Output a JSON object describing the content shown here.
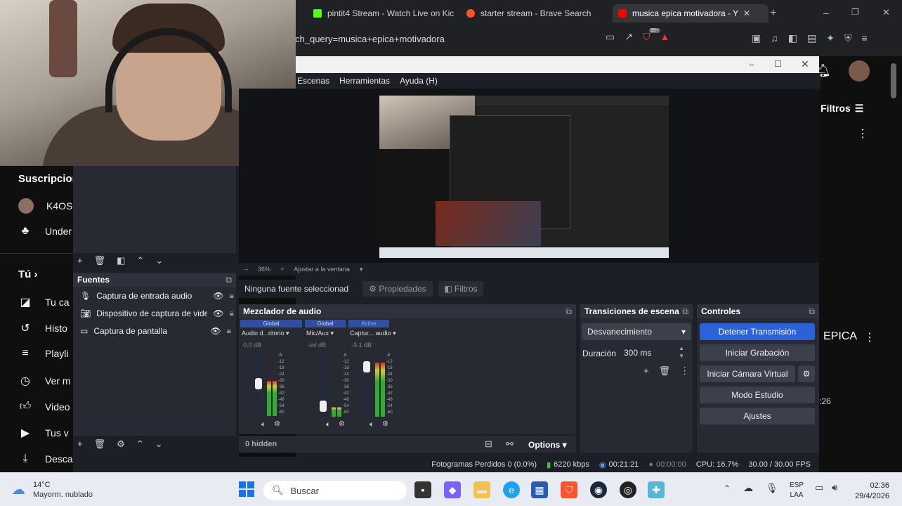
{
  "browser": {
    "tabs": [
      {
        "title": "pintit4 Stream - Watch Live on Kic",
        "fav": "#53fc18"
      },
      {
        "title": "starter stream - Brave Search",
        "fav": "#fb542b"
      },
      {
        "title": "musica epica motivadora - Yo",
        "fav": "#ff0000"
      }
    ],
    "address": "ch_query=musica+epica+motivadora",
    "shields_badge": "99+"
  },
  "youtube": {
    "subs_heading": "Suscripcion",
    "sub_items": [
      "K4OS",
      "Under"
    ],
    "you_heading": "Tú",
    "you_items": [
      "Tu ca",
      "Histo",
      "Playli",
      "Ver m",
      "Video",
      "Tus v",
      "Desca"
    ],
    "filters": "Filtros",
    "epica_fragment": "EPICA",
    "time_fragment": ":26"
  },
  "obs": {
    "menu": [
      "Escenas",
      "Herramientas",
      "Ayuda (H)"
    ],
    "zoom": "36%",
    "fit_label": "Ajustar a la ventana",
    "no_source": "Ninguna fuente seleccionad",
    "properties": "Propiedades",
    "filters": "Filtros",
    "sources_title": "Fuentes",
    "sources": [
      {
        "label": "Captura de entrada audio",
        "icon": "mic-icon"
      },
      {
        "label": "Dispositivo de captura de video",
        "icon": "camera-icon"
      },
      {
        "label": "Captura de pantalla",
        "icon": "monitor-icon"
      }
    ],
    "mixer_title": "Mezclador de audio",
    "mixer": [
      {
        "tag": "Global",
        "name": "Audio d...ritorio",
        "db": "0.0 dB",
        "level": 0.55
      },
      {
        "tag": "Global",
        "name": "Mic/Aux",
        "db": "-inf dB",
        "level": 0.15
      },
      {
        "tag": "Active",
        "name": "Captur... audio",
        "db": "-3.1 dB",
        "level": 0.85
      }
    ],
    "ticks": [
      "-6",
      "-12",
      "-18",
      "-24",
      "-30",
      "-36",
      "-42",
      "-48",
      "-54",
      "-60"
    ],
    "hidden": "0 hidden",
    "options": "Options",
    "transitions_title": "Transiciones de escena",
    "transition_value": "Desvanecimiento",
    "duration_label": "Duración",
    "duration_value": "300 ms",
    "controls_title": "Controles",
    "controls": [
      "Detener Transmisión",
      "Iniciar Grabación",
      "Iniciar Cámara Virtual",
      "Modo Estudio",
      "Ajustes"
    ],
    "status": {
      "dropped": "Fotogramas Perdidos 0 (0.0%)",
      "kbps": "6220 kbps",
      "live": "00:21:21",
      "rec": "00:00:00",
      "cpu": "CPU: 16.7%",
      "fps": "30.00 / 30.00 FPS"
    }
  },
  "taskbar": {
    "temp": "14°C",
    "weather": "Mayorm. nublado",
    "search": "Buscar",
    "lang1": "ESP",
    "lang2": "LAA",
    "time": "02:36",
    "date": "29/4/2026"
  }
}
